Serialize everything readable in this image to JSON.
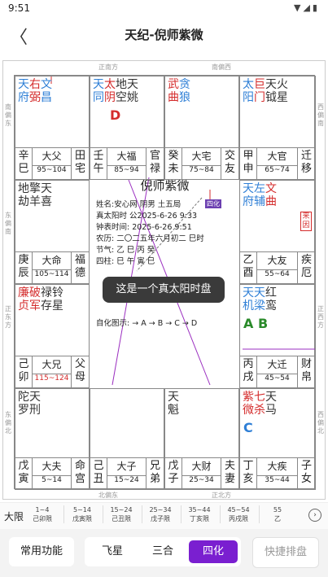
{
  "status": {
    "time": "9:51",
    "icons": "▼◢▮"
  },
  "header": {
    "back": "〈",
    "title": "天纪-倪师紫微"
  },
  "dirs": {
    "top_mid": "正南方",
    "top_right": "南偏西",
    "bot_left": "北偏东",
    "bot_right": "正北方",
    "left_1": "南偏东",
    "left_2": "东偏南",
    "left_3": "正东方",
    "left_4": "东偏北",
    "right_1": "西偏南",
    "right_2": "正西方",
    "right_3": "西偏北"
  },
  "palaces": [
    {
      "id": "si",
      "stars": [
        [
          "天",
          "府"
        ],
        [
          "右",
          "弼"
        ],
        [
          "文",
          "昌"
        ]
      ],
      "colors": [
        "blue",
        "red",
        "blue"
      ],
      "gz": [
        "辛",
        "巳"
      ],
      "name": "大父",
      "range": "95~104",
      "pal": [
        "田",
        "宅"
      ]
    },
    {
      "id": "wu",
      "stars": [
        [
          "天",
          "同"
        ],
        [
          "太",
          "阴"
        ],
        [
          "地",
          "空"
        ],
        [
          "天",
          "姚"
        ]
      ],
      "colors": [
        "blue",
        "red",
        "dark",
        "dark"
      ],
      "extra": "D",
      "gz": [
        "壬",
        "午"
      ],
      "name": "大福",
      "range": "85~94",
      "pal": [
        "官",
        "禄"
      ]
    },
    {
      "id": "wei",
      "stars": [
        [
          "武",
          "曲"
        ],
        [
          "贪",
          "狼"
        ]
      ],
      "colors": [
        "red",
        "blue"
      ],
      "gz": [
        "癸",
        "未"
      ],
      "name": "大宅",
      "range": "75~84",
      "pal": [
        "交",
        "友"
      ]
    },
    {
      "id": "shen",
      "stars": [
        [
          "太",
          "阳"
        ],
        [
          "巨",
          "门"
        ],
        [
          "天",
          "钺"
        ],
        [
          "火",
          "星"
        ]
      ],
      "colors": [
        "blue",
        "red",
        "dark",
        "dark"
      ],
      "gz": [
        "甲",
        "申"
      ],
      "name": "大官",
      "range": "65~74",
      "pal": [
        "迁",
        "移"
      ]
    },
    {
      "id": "chen",
      "stars": [
        [
          "地",
          "劫"
        ],
        [
          "擎",
          "羊"
        ],
        [
          "天",
          "喜"
        ]
      ],
      "colors": [
        "dark",
        "dark",
        "dark"
      ],
      "gz": [
        "庚",
        "辰"
      ],
      "name": "大命",
      "range": "105~114",
      "pal": [
        "福",
        "德"
      ]
    },
    {
      "id": "you",
      "stars": [
        [
          "天",
          "府"
        ],
        [
          "左",
          "辅"
        ],
        [
          "文",
          "曲"
        ]
      ],
      "colors": [
        "blue",
        "blue",
        "red"
      ],
      "gz": [
        "乙",
        "酉"
      ],
      "name": "大友",
      "range": "55~64",
      "pal": [
        "疾",
        "厄"
      ],
      "stamp": "来因"
    },
    {
      "id": "mao",
      "stars": [
        [
          "廉",
          "贞"
        ],
        [
          "破",
          "军"
        ],
        [
          "禄",
          "存"
        ],
        [
          "铃",
          "星"
        ]
      ],
      "colors": [
        "red",
        "red",
        "dark",
        "dark"
      ],
      "gz": [
        "己",
        "卯"
      ],
      "name": "大兄",
      "range": "115~124",
      "pal": [
        "父",
        "母"
      ]
    },
    {
      "id": "xu",
      "stars": [
        [
          "天",
          "机"
        ],
        [
          "天",
          "梁"
        ],
        [
          "红",
          "鸾"
        ]
      ],
      "colors": [
        "blue",
        "blue",
        "dark"
      ],
      "extra": "A B",
      "gz": [
        "丙",
        "戌"
      ],
      "name": "大迁",
      "range": "45~54",
      "pal": [
        "财",
        "帛"
      ]
    },
    {
      "id": "yin",
      "stars": [
        [
          "陀",
          "罗"
        ],
        [
          "天",
          "刑"
        ]
      ],
      "colors": [
        "dark",
        "dark"
      ],
      "gz": [
        "戊",
        "寅"
      ],
      "name": "大夫",
      "range": "5~14",
      "pal": [
        "命",
        "宫"
      ]
    },
    {
      "id": "chou",
      "stars": [],
      "colors": [],
      "gz": [
        "己",
        "丑"
      ],
      "name": "大子",
      "range": "15~24",
      "pal": [
        "兄",
        "弟"
      ]
    },
    {
      "id": "zi",
      "stars": [
        [
          "天",
          "魁"
        ]
      ],
      "colors": [
        "dark"
      ],
      "gz": [
        "戊",
        "子"
      ],
      "name": "大财",
      "range": "25~34",
      "pal": [
        "夫",
        "妻"
      ]
    },
    {
      "id": "hai",
      "stars": [
        [
          "紫",
          "微"
        ],
        [
          "七",
          "杀"
        ],
        [
          "天",
          "马"
        ]
      ],
      "colors": [
        "red",
        "red",
        "dark"
      ],
      "extra": "C",
      "gz": [
        "丁",
        "亥"
      ],
      "name": "大疾",
      "range": "35~44",
      "pal": [
        "子",
        "女"
      ]
    }
  ],
  "center": {
    "title": "倪师紫微",
    "l1": "姓名:安心网      阴男      土五局",
    "l2": "真太阳时        公2025-6-26 9:33",
    "l3": "钟表时间:       2025-6-26 9:51",
    "l4": "农历:      二〇二五年六月初二 巳时",
    "l5": "节气:       乙      巳      丙      癸",
    "l6": "四柱:       巳      午      寅      巳",
    "l7": "自化图示:  → A  → B  → C  → D",
    "badge": "四化"
  },
  "toast": "这是一个真太阳时盘",
  "daxian": {
    "label": "大限",
    "items": [
      {
        "r": "1~4",
        "p": "己卯限"
      },
      {
        "r": "5~14",
        "p": "戊寅限"
      },
      {
        "r": "15~24",
        "p": "己丑限"
      },
      {
        "r": "25~34",
        "p": "戊子限"
      },
      {
        "r": "35~44",
        "p": "丁亥限"
      },
      {
        "r": "45~54",
        "p": "丙戌限"
      },
      {
        "r": "55",
        "p": "乙"
      }
    ],
    "next": "›"
  },
  "footer": {
    "common": "常用功能",
    "tabs": [
      "飞星",
      "三合",
      "四化"
    ],
    "active": "四化",
    "quick": "快捷排盘"
  },
  "colors": {
    "accent": "#7a1fd0",
    "red": "#d42c2c",
    "blue": "#2f7fd6"
  }
}
